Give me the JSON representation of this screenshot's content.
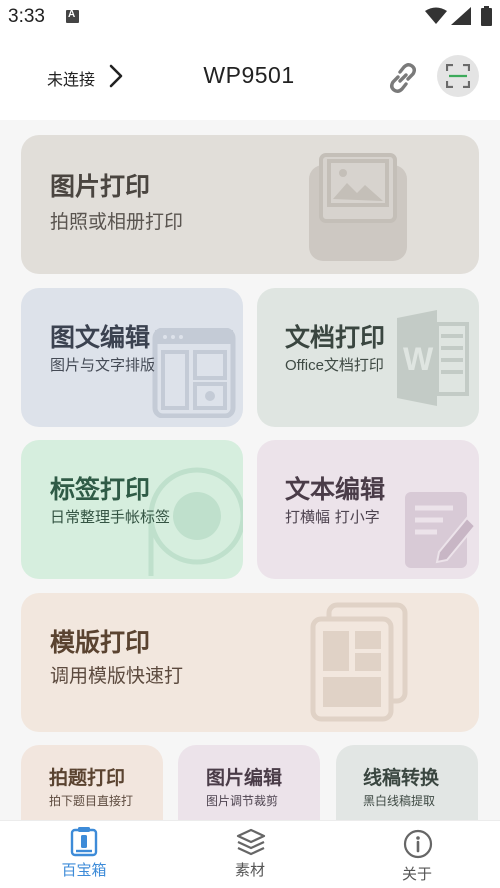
{
  "status_bar": {
    "time": "3:33"
  },
  "header": {
    "connection_label": "未连接",
    "device_name": "WP9501",
    "icons": [
      "chevron-right-icon",
      "link-icon",
      "scan-icon"
    ]
  },
  "cards": {
    "photo_print": {
      "title": "图片打印",
      "subtitle": "拍照或相册打印"
    },
    "image_text_edit": {
      "title": "图文编辑",
      "subtitle": "图片与文字排版"
    },
    "doc_print": {
      "title": "文档打印",
      "subtitle": "Office文档打印"
    },
    "label_print": {
      "title": "标签打印",
      "subtitle": "日常整理手帐标签"
    },
    "text_edit": {
      "title": "文本编辑",
      "subtitle": "打横幅 打小字"
    },
    "template_print": {
      "title": "模版打印",
      "subtitle": "调用模版快速打"
    },
    "question_print": {
      "title": "拍题打印",
      "subtitle": "拍下题目直接打"
    },
    "image_edit": {
      "title": "图片编辑",
      "subtitle": "图片调节裁剪"
    },
    "line_convert": {
      "title": "线稿转换",
      "subtitle": "黑白线稿提取"
    }
  },
  "bottom_nav": {
    "items": [
      {
        "label": "百宝箱",
        "icon": "toolbox-icon",
        "active": true
      },
      {
        "label": "素材",
        "icon": "layers-icon",
        "active": false
      },
      {
        "label": "关于",
        "icon": "info-icon",
        "active": false
      }
    ]
  },
  "colors": {
    "accent": "#3d8bd8",
    "photo_card": "#e1ded9",
    "image_text_card": "#dde2ea",
    "doc_card": "#dfe5e1",
    "label_card": "#d6eede",
    "text_card": "#ece3ea",
    "template_card": "#f2e7de"
  }
}
